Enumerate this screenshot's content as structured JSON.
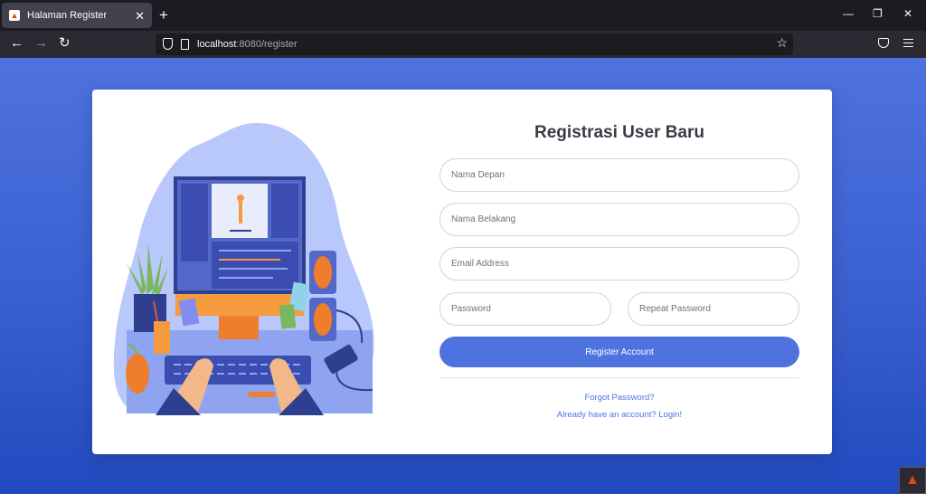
{
  "browser": {
    "tab_title": "Halaman Register",
    "url_host": "localhost",
    "url_rest": ":8080/register",
    "icons": {
      "favicon": "codeigniter-flame-icon",
      "tab_close": "close-icon",
      "new_tab": "plus-icon",
      "minimize": "minimize-icon",
      "restore": "restore-icon",
      "close": "close-icon",
      "back": "arrow-left-icon",
      "forward": "arrow-right-icon",
      "reload": "reload-icon",
      "shield": "shield-icon",
      "page": "page-icon",
      "bookmark": "star-icon",
      "pocket": "pocket-icon",
      "menu": "hamburger-menu-icon"
    }
  },
  "page": {
    "title": "Registrasi User Baru",
    "fields": {
      "first_name_placeholder": "Nama Depan",
      "last_name_placeholder": "Nama Belakang",
      "email_placeholder": "Email Address",
      "password_placeholder": "Password",
      "repeat_password_placeholder": "Repeat Password"
    },
    "submit_label": "Register Account",
    "forgot_password_link": "Forgot Password?",
    "login_link": "Already have an account? Login!"
  },
  "colors": {
    "primary": "#4e73df",
    "background_gradient_start": "#4e73df",
    "background_gradient_end": "#224abe",
    "text": "#3a3b45",
    "placeholder": "#6e707e"
  }
}
